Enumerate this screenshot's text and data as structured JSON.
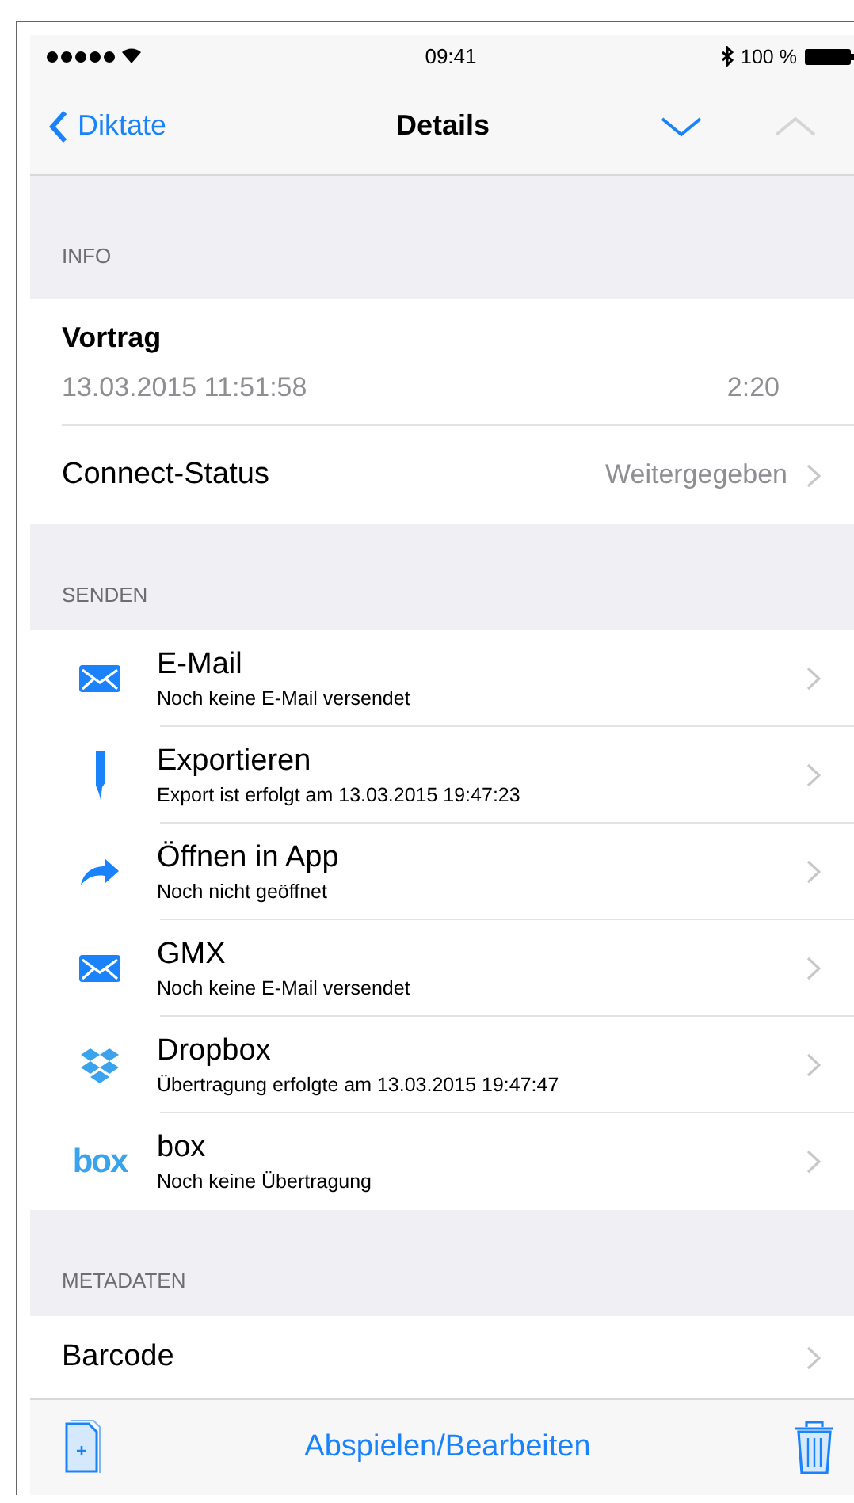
{
  "status_bar": {
    "time": "09:41",
    "battery": "100 %"
  },
  "nav": {
    "back": "Diktate",
    "title": "Details",
    "buttons": [
      {
        "kind": "down",
        "disabled": false
      },
      {
        "kind": "up",
        "disabled": true
      }
    ]
  },
  "sections": [
    {
      "header": "INFO",
      "rows": [
        {
          "kind": "record",
          "title": "Vortrag",
          "date": "13.03.2015 11:51:58",
          "duration": "2:20"
        },
        {
          "kind": "value",
          "title": "Connect-Status",
          "value": "Weitergegeben"
        }
      ]
    },
    {
      "header": "SENDEN",
      "rows": [
        {
          "kind": "mail",
          "title": "E-Mail",
          "subtitle": "Noch keine E-Mail versendet"
        },
        {
          "kind": "export",
          "title": "Exportieren",
          "subtitle": "Export ist erfolgt am 13.03.2015 19:47:23"
        },
        {
          "kind": "share",
          "title": "Öffnen in App",
          "subtitle": "Noch nicht geöffnet"
        },
        {
          "kind": "mail",
          "title": "GMX",
          "subtitle": "Noch keine E-Mail versendet"
        },
        {
          "kind": "dropbox",
          "title": "Dropbox",
          "subtitle": "Übertragung erfolgte am 13.03.2015 19:47:47"
        },
        {
          "kind": "logo",
          "logo": "box",
          "title": "box",
          "subtitle": "Noch keine Übertragung"
        }
      ]
    },
    {
      "header": "METADATEN",
      "rows": [
        {
          "kind": "value",
          "title": "Barcode"
        }
      ]
    }
  ],
  "toolbar": {
    "action": "Abspielen/Bearbeiten"
  }
}
